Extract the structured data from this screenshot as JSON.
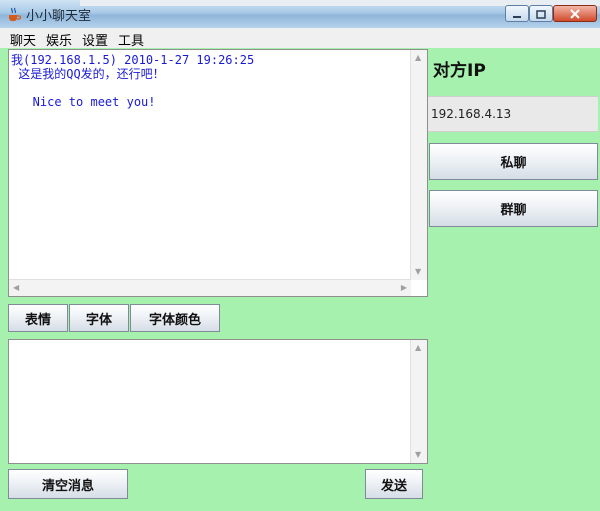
{
  "window": {
    "title": "小小聊天室"
  },
  "menu": [
    "聊天",
    "娱乐",
    "设置",
    "工具"
  ],
  "chat": {
    "header_line": "我(192.168.1.5) 2010-1-27 19:26:25",
    "line1": " 这是我的QQ发的，还行吧！",
    "line2": "   Nice to meet you!"
  },
  "toolbar": {
    "emoji": "表情",
    "font": "字体",
    "font_color": "字体颜色"
  },
  "actions": {
    "clear": "清空消息",
    "send": "发送"
  },
  "peer": {
    "title": "对方IP",
    "ip": "192.168.4.13",
    "private_chat": "私聊",
    "group_chat": "群聊"
  },
  "icons": {
    "app": "java-coffee-icon",
    "minimize": "minimize-icon",
    "maximize": "maximize-icon",
    "close": "close-icon"
  },
  "colors": {
    "panel_bg": "#a6f1ad",
    "chat_text": "#1a1ad6"
  }
}
